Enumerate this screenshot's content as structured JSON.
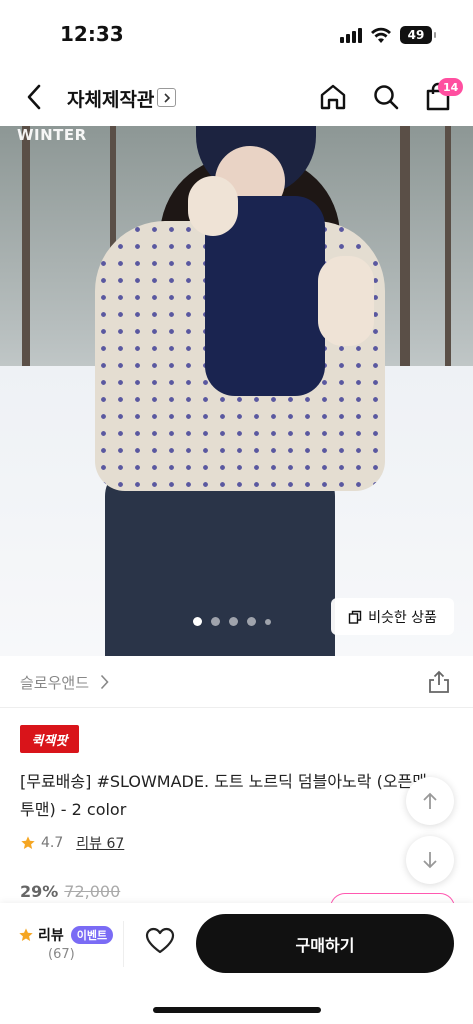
{
  "status": {
    "time": "12:33",
    "battery": "49"
  },
  "header": {
    "title": "자체제작관",
    "cart_count": "14"
  },
  "hero": {
    "watermark": "WINTER",
    "similar_label": "비슷한 상품",
    "slide_count": 5,
    "active_slide": 1
  },
  "brand": {
    "name": "슬로우앤드"
  },
  "product": {
    "badge": "퀵잭팟",
    "title": "[무료배송]  #SLOWMADE. 도트 노르딕 덤블아노락 (오픈맨투맨) - 2 color",
    "rating": "4.7",
    "review_link": "리뷰 67",
    "discount": "29%",
    "original_price": "72,000"
  },
  "bottom": {
    "review_label": "리뷰",
    "event_label": "이벤트",
    "review_count": "(67)",
    "buy_label": "구매하기"
  },
  "colors": {
    "accent_pink": "#ff4fa0",
    "event_purple": "#7a6bf5",
    "badge_red": "#d9141a",
    "star": "#f5a623"
  }
}
